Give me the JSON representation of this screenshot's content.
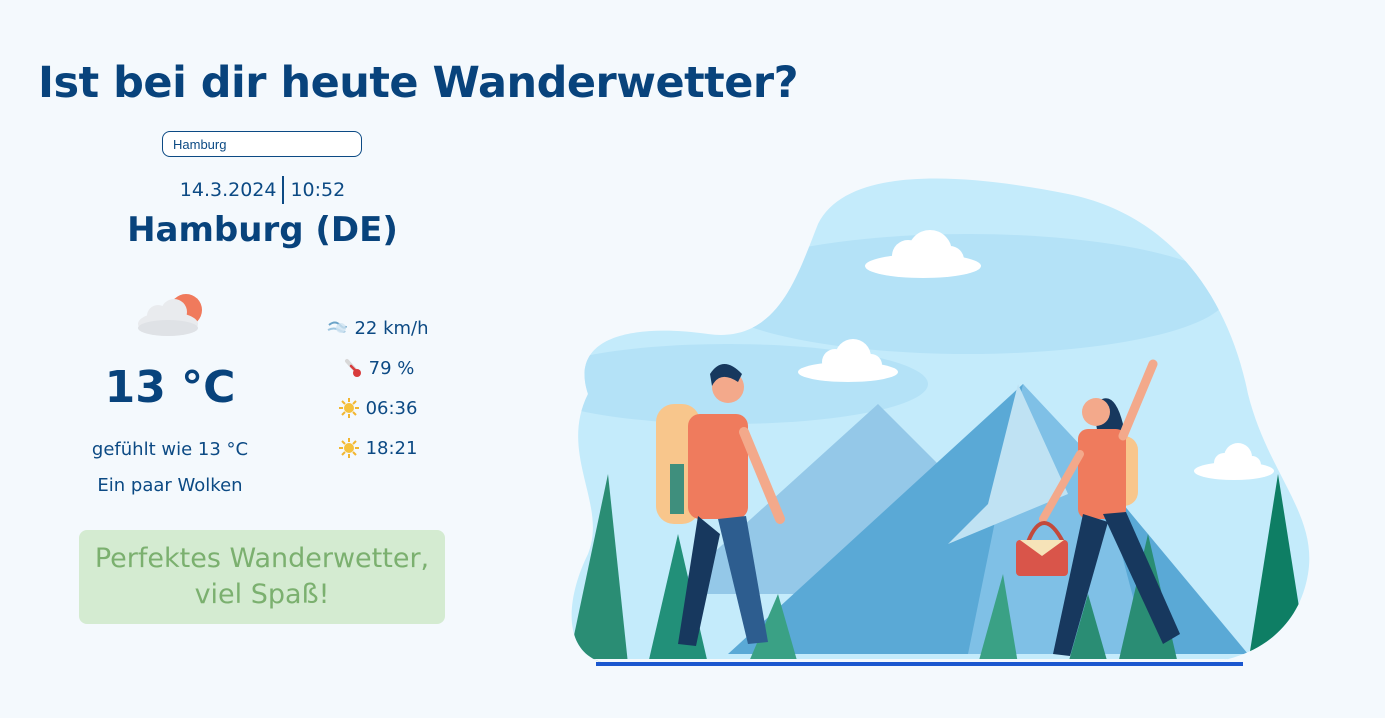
{
  "header": {
    "title": "Ist bei dir heute Wanderwetter?"
  },
  "search": {
    "value": "Hamburg"
  },
  "datetime": {
    "date": "14.3.2024",
    "time": "10:52"
  },
  "location": {
    "city": "Hamburg (DE)"
  },
  "current": {
    "icon": "sun-behind-cloud-icon",
    "temperature": "13 °C",
    "feels_like": "gefühlt wie 13 °C",
    "description": "Ein paar Wolken"
  },
  "stats": {
    "wind": "22 km/h",
    "humidity": "79 %",
    "sunrise": "06:36",
    "sunset": "18:21"
  },
  "verdict": {
    "text": "Perfektes Wanderwetter, viel Spaß!"
  },
  "colors": {
    "background": "#f4f9fd",
    "primary": "#08437c",
    "verdict_bg": "#d4ebd1",
    "verdict_text": "#7bb06f"
  }
}
